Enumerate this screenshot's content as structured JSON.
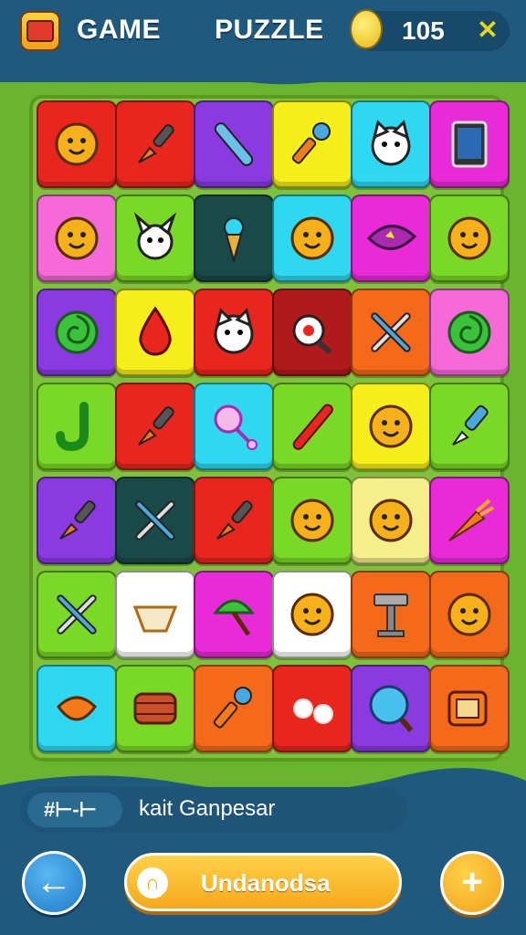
{
  "header": {
    "title_left": "GAME",
    "title_right": "PUZZLE",
    "score": "105",
    "logo_icon": "treasure-chest-icon",
    "coin_icon": "coin-face-icon",
    "close_icon": "close-x-icon"
  },
  "colors": {
    "header_bg": "#1f5a7e",
    "board_bg": "#7dc23a",
    "page_bg": "#6ab52e",
    "primary_button": "#f5a81a",
    "back_button": "#1e78c8"
  },
  "board": {
    "rows": [
      [
        {
          "icon": "sun-face-icon",
          "color": "#e8261e"
        },
        {
          "icon": "paintbrush-icon",
          "color": "#e8261e"
        },
        {
          "icon": "pen-icon",
          "color": "#8a3ae0"
        },
        {
          "icon": "microphone-icon",
          "color": "#f5ee1a"
        },
        {
          "icon": "cat-face-icon",
          "color": "#2ed8f0"
        },
        {
          "icon": "tablet-icon",
          "color": "#e82ad8"
        }
      ],
      [
        {
          "icon": "moon-face-icon",
          "color": "#f56ad8"
        },
        {
          "icon": "rabbit-face-icon",
          "color": "#7ad826"
        },
        {
          "icon": "ice-cream-icon",
          "color": "#1a4a48"
        },
        {
          "icon": "flower-face-icon",
          "color": "#2ed8f0"
        },
        {
          "icon": "leaf-icon",
          "color": "#e82ad8"
        },
        {
          "icon": "monster-face-icon",
          "color": "#7ad826"
        }
      ],
      [
        {
          "icon": "swirl-icon",
          "color": "#8a3ae0"
        },
        {
          "icon": "drop-icon",
          "color": "#f5ee1a"
        },
        {
          "icon": "cat-face-icon",
          "color": "#e8261e"
        },
        {
          "icon": "frying-pan-icon",
          "color": "#b01a1a"
        },
        {
          "icon": "crossed-tools-icon",
          "color": "#f56a1a"
        },
        {
          "icon": "swirl-icon",
          "color": "#f56ad8"
        }
      ],
      [
        {
          "icon": "hook-icon",
          "color": "#7ad826"
        },
        {
          "icon": "paintbrush-icon",
          "color": "#e8261e"
        },
        {
          "icon": "rattle-icon",
          "color": "#2ed8f0"
        },
        {
          "icon": "flute-icon",
          "color": "#7ad826"
        },
        {
          "icon": "flower-face-icon",
          "color": "#f5ee1a"
        },
        {
          "icon": "pipette-icon",
          "color": "#7ad826"
        }
      ],
      [
        {
          "icon": "paintbrush-icon",
          "color": "#8a3ae0"
        },
        {
          "icon": "crossed-tools-icon",
          "color": "#1a4a48"
        },
        {
          "icon": "paintbrush-icon",
          "color": "#e8261e"
        },
        {
          "icon": "mask-face-icon",
          "color": "#7ad826"
        },
        {
          "icon": "bell-face-icon",
          "color": "#f5ee8a"
        },
        {
          "icon": "carrot-icon",
          "color": "#e82ad8"
        }
      ],
      [
        {
          "icon": "crossed-tools-icon",
          "color": "#7ad826"
        },
        {
          "icon": "bowl-icon",
          "color": "#ffffff"
        },
        {
          "icon": "umbrella-icon",
          "color": "#e82ad8"
        },
        {
          "icon": "flower-face-icon",
          "color": "#ffffff"
        },
        {
          "icon": "hammer-icon",
          "color": "#f56a1a"
        },
        {
          "icon": "shield-face-icon",
          "color": "#f56a1a"
        }
      ],
      [
        {
          "icon": "spinning-top-icon",
          "color": "#2ed8f0"
        },
        {
          "icon": "barrel-icon",
          "color": "#7ad826"
        },
        {
          "icon": "microphone-icon",
          "color": "#f56a1a"
        },
        {
          "icon": "balls-icon",
          "color": "#e8261e"
        },
        {
          "icon": "magnifier-icon",
          "color": "#8a3ae0"
        },
        {
          "icon": "radio-icon",
          "color": "#f56a1a"
        }
      ]
    ]
  },
  "footer": {
    "hint_tag": "#⊢-⊢",
    "hint_text": "kait Ganpesar",
    "main_button_label": "Undanodsa",
    "back_icon": "arrow-left-icon",
    "main_button_icon": "headphones-icon",
    "plus_icon": "plus-icon"
  }
}
